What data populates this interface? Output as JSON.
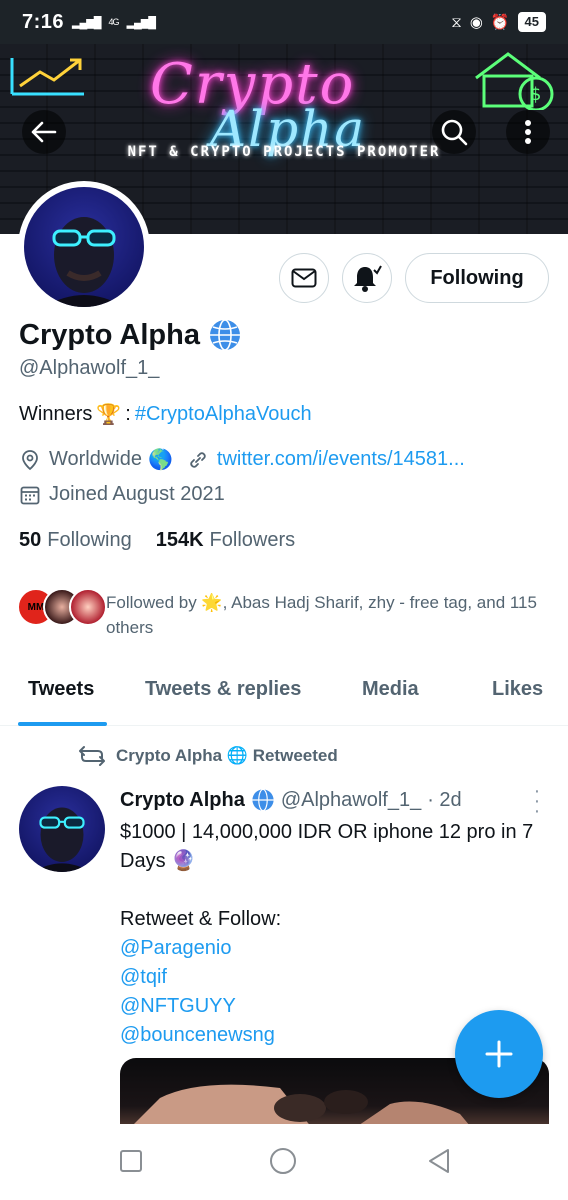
{
  "status_bar": {
    "time": "7:16",
    "network": "4G",
    "battery": "45"
  },
  "banner": {
    "title_line1": "Crypto",
    "title_line2": "Alpha",
    "tagline": "NFT & CRYPTO PROJECTS PROMOTER"
  },
  "profile": {
    "name": "Crypto Alpha",
    "handle": "@Alphawolf_1_",
    "bio_prefix": "Winners",
    "bio_emoji": "🏆",
    "bio_colon": ":",
    "bio_hashtag": "#CryptoAlphaVouch",
    "location": "Worldwide",
    "location_emoji": "🌎",
    "link": "twitter.com/i/events/14581...",
    "joined": "Joined August 2021",
    "following_count": "50",
    "following_label": "Following",
    "followers_count": "154K",
    "followers_label": "Followers",
    "followed_by": "Followed by 🌟, Abas Hadj Sharif, zhy - free tag, and 115 others",
    "following_button": "Following"
  },
  "tabs": [
    {
      "label": "Tweets",
      "active": true
    },
    {
      "label": "Tweets & replies",
      "active": false
    },
    {
      "label": "Media",
      "active": false
    },
    {
      "label": "Likes",
      "active": false
    }
  ],
  "tweet": {
    "retweet_label": "Crypto Alpha 🌐 Retweeted",
    "author_name": "Crypto Alpha",
    "author_handle": "@Alphawolf_1_",
    "time": "· 2d",
    "line1": "$1000 | 14,000,000 IDR OR iphone 12 pro in 7 Days 🔮",
    "line2": "Retweet & Follow:",
    "mentions": [
      "@Paragenio",
      "@tqif",
      "@NFTGUYY",
      "@bouncenewsng"
    ]
  },
  "colors": {
    "accent": "#1d9bf0",
    "text_primary": "#0f1419",
    "text_secondary": "#536471"
  },
  "icons": [
    "back-arrow-icon",
    "search-icon",
    "more-icon",
    "envelope-icon",
    "bell-icon",
    "location-pin-icon",
    "link-icon",
    "calendar-icon",
    "retweet-icon",
    "globe-icon",
    "plus-icon"
  ]
}
